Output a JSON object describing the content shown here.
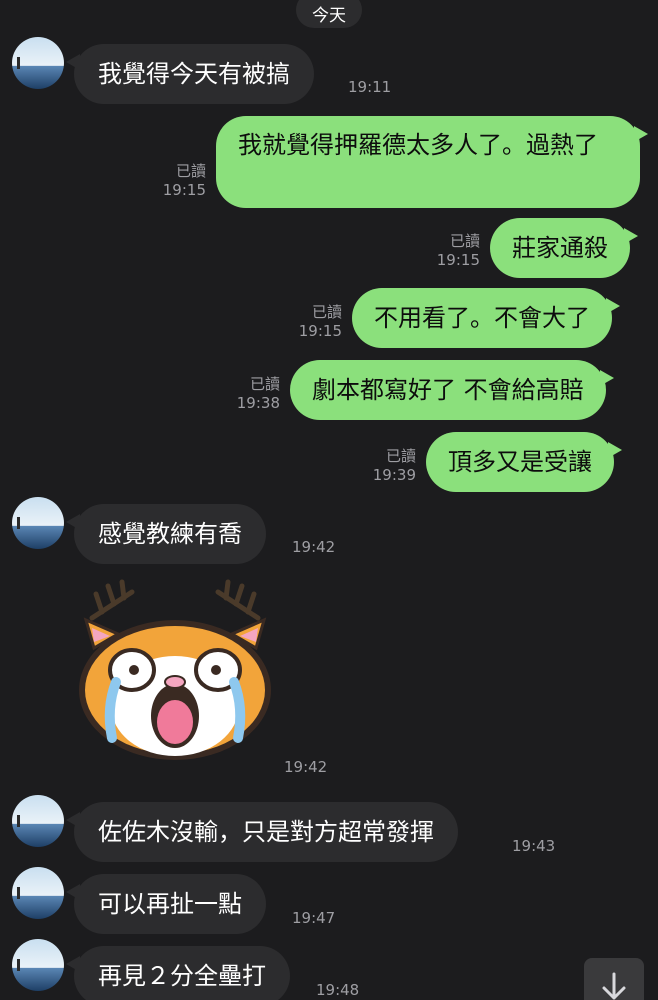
{
  "date_separator": "今天",
  "colors": {
    "background": "#1c1c1e",
    "incoming_bubble": "#2c2c2e",
    "outgoing_bubble": "#8be07c",
    "timestamp": "#9e9ea3"
  },
  "messages": [
    {
      "direction": "in",
      "text": "我覺得今天有被搞",
      "time": "19:11"
    },
    {
      "direction": "out",
      "text": "我就覺得押羅德太多人了。過熱了",
      "read": "已讀",
      "time": "19:15"
    },
    {
      "direction": "out",
      "text": "莊家通殺",
      "read": "已讀",
      "time": "19:15"
    },
    {
      "direction": "out",
      "text": "不用看了。不會大了",
      "read": "已讀",
      "time": "19:15"
    },
    {
      "direction": "out",
      "text": "劇本都寫好了 不會給高賠",
      "read": "已讀",
      "time": "19:38"
    },
    {
      "direction": "out",
      "text": "頂多又是受讓",
      "read": "已讀",
      "time": "19:39"
    },
    {
      "direction": "in",
      "text": "感覺教練有喬",
      "time": "19:42"
    },
    {
      "direction": "in",
      "type": "sticker",
      "sticker": "crying-cat-sticker",
      "time": "19:42"
    },
    {
      "direction": "in",
      "text": "佐佐木沒輸，只是對方超常發揮",
      "time": "19:43"
    },
    {
      "direction": "in",
      "text": "可以再扯一點",
      "time": "19:47"
    },
    {
      "direction": "in",
      "text": "再見２分全壘打",
      "time": "19:48"
    }
  ],
  "icons": {
    "avatar": "avatar-sky-landscape",
    "scroll": "arrow-down-icon"
  }
}
